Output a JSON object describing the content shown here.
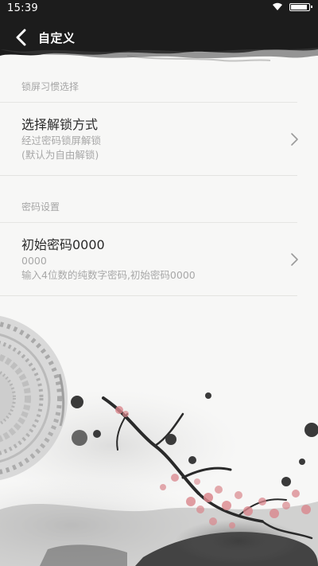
{
  "status_bar": {
    "time": "15:39",
    "battery_level": 0.85
  },
  "header": {
    "title": "自定义",
    "back_icon": "chevron-left-icon"
  },
  "sections": [
    {
      "header": "锁屏习惯选择",
      "items": [
        {
          "title": "选择解锁方式",
          "subtitle_lines": [
            "经过密码锁屏解锁",
            "(默认为自由解锁)"
          ],
          "icon": "chevron-right-icon"
        }
      ]
    },
    {
      "header": "密码设置",
      "items": [
        {
          "title": "初始密码0000",
          "subtitle_lines": [
            "0000",
            "输入4位数的纯数字密码,初始密码0000"
          ],
          "icon": "chevron-right-icon"
        }
      ]
    }
  ],
  "colors": {
    "header_ink": "#1c1c1c",
    "background": "#f7f7f6",
    "title_text": "#2b2b2b",
    "secondary_text": "#a8a8a8",
    "blossom": "#d9868c"
  }
}
